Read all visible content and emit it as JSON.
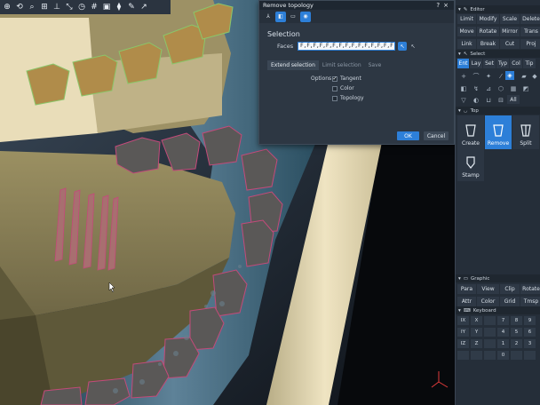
{
  "toolbar": {
    "icons": [
      "cursor-icon",
      "zoom-icon",
      "search-icon",
      "grid-icon",
      "axis-icon",
      "measure-icon",
      "clock-icon",
      "hash-icon",
      "frame-icon",
      "layers-icon",
      "brush-icon",
      "arrow-icon"
    ]
  },
  "dialog": {
    "title": "Remove topology",
    "help": "?",
    "close": "×",
    "section": "Selection",
    "faces_label": "Faces",
    "faces_value": "F,F,F,F,F,F,F,F,F,F,F,F,F,F,F",
    "tabs": [
      "Extend selection",
      "Limit selection",
      "Save"
    ],
    "options_label": "Options",
    "options": [
      {
        "label": "Tangent",
        "checked": true
      },
      {
        "label": "Color",
        "checked": false
      },
      {
        "label": "Topology",
        "checked": false
      }
    ],
    "ok": "OK",
    "cancel": "Cancel"
  },
  "panel": {
    "editor": {
      "title": "Editor",
      "rows": [
        [
          "Limit",
          "Modify",
          "Scale",
          "Delete"
        ],
        [
          "Move",
          "Rotate",
          "Mirror",
          "Trans"
        ],
        [
          "Link",
          "Break",
          "Cut",
          "Proj"
        ]
      ]
    },
    "select": {
      "title": "Select",
      "tabs": [
        "Ent",
        "Lay",
        "Set",
        "Typ",
        "Col",
        "Tip"
      ],
      "all_label": "All"
    },
    "top": {
      "title": "Top",
      "tiles": [
        "Create",
        "Remove",
        "Split",
        "Stamp"
      ]
    },
    "graphic": {
      "title": "Graphic",
      "rows": [
        [
          "Para",
          "View",
          "Clip",
          "Rotate"
        ],
        [
          "Attr",
          "Color",
          "Grid",
          "Tmsp"
        ]
      ]
    },
    "keyboard": {
      "title": "Keyboard",
      "rows": [
        [
          "IX",
          "X",
          "",
          "7",
          "8",
          "9"
        ],
        [
          "IY",
          "Y",
          "",
          "4",
          "5",
          "6"
        ],
        [
          "IZ",
          "Z",
          "",
          "1",
          "2",
          "3"
        ],
        [
          "",
          "",
          "",
          "0",
          "",
          ""
        ]
      ]
    }
  },
  "colors": {
    "accent": "#2d7fd8",
    "tooth": "#7d7550",
    "tooth_light": "#e8dcb8",
    "highlight": "#c44a7a"
  }
}
